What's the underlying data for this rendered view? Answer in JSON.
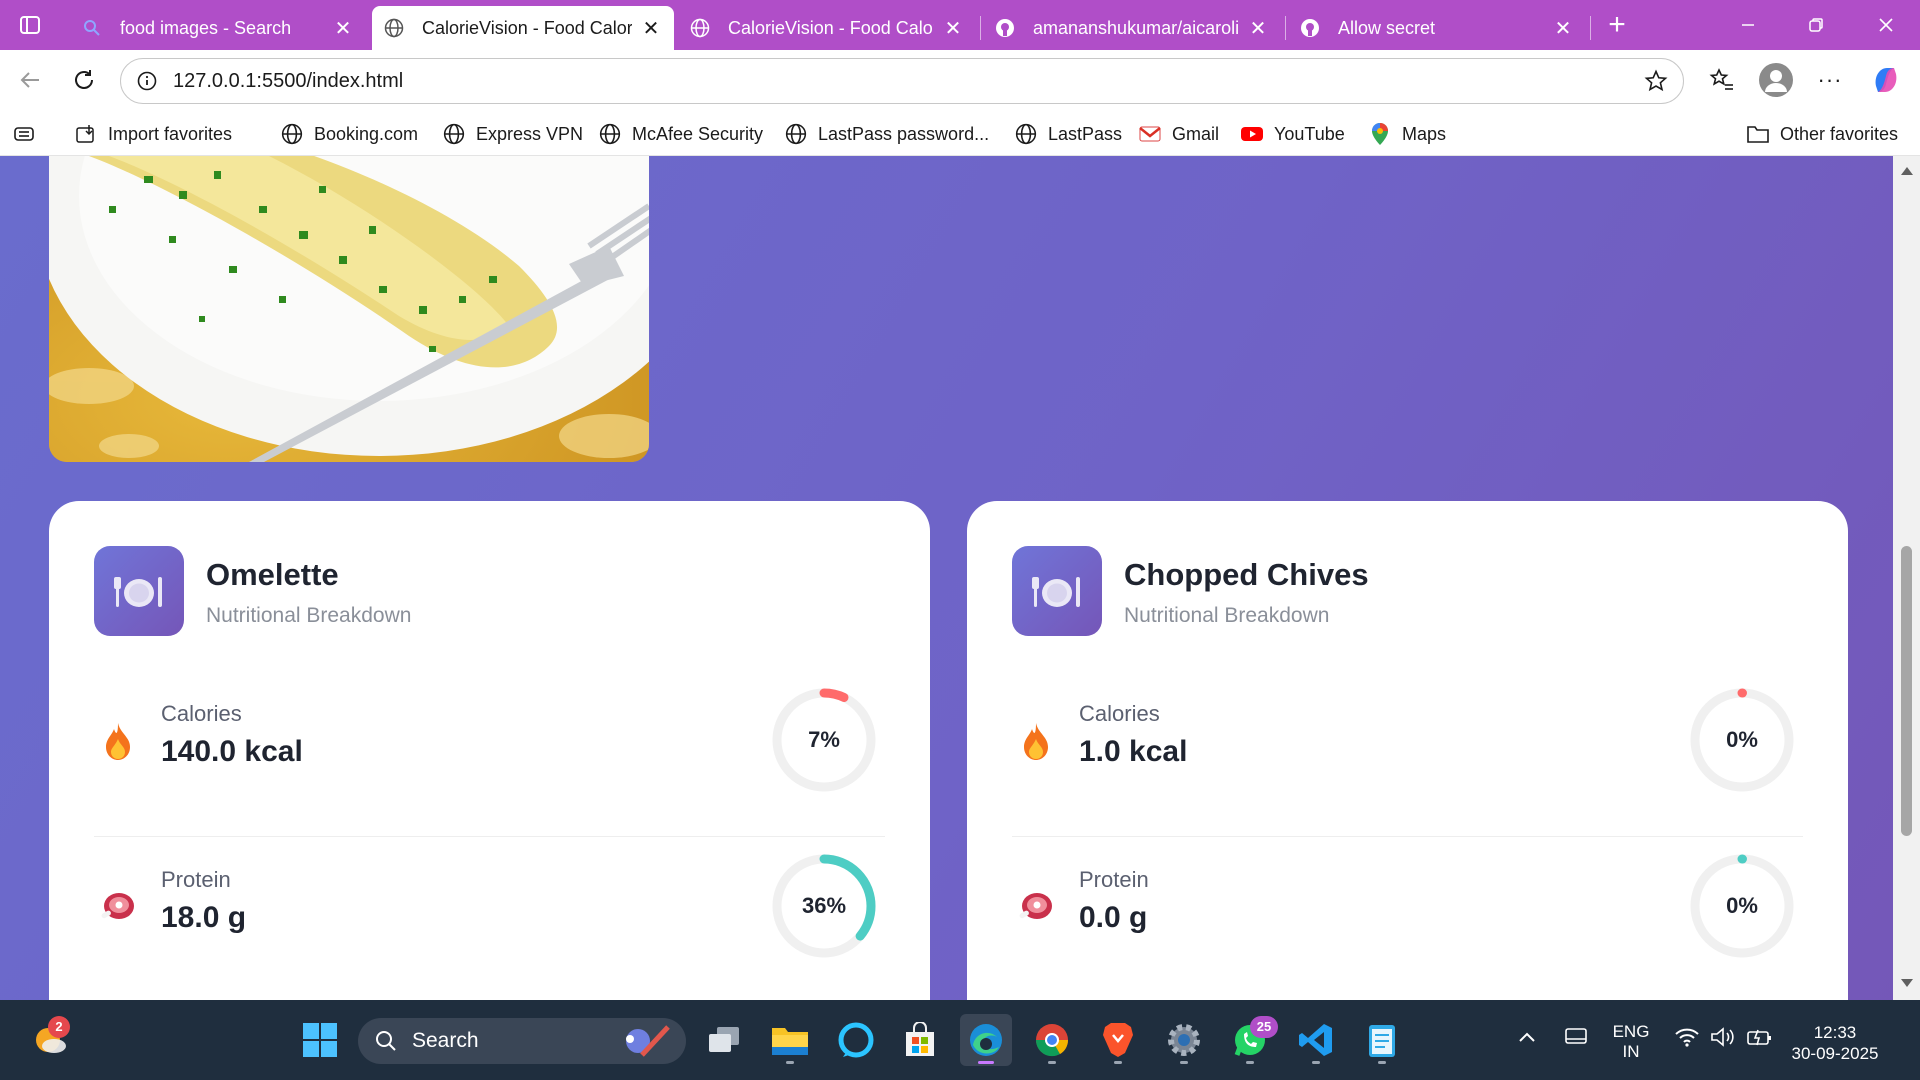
{
  "browser": {
    "tabs": [
      {
        "title": "food images - Search",
        "active": false,
        "icon": "search-icon"
      },
      {
        "title": "CalorieVision - Food Calori",
        "active": true,
        "icon": "globe-icon"
      },
      {
        "title": "CalorieVision - Food Calori",
        "active": false,
        "icon": "globe-icon"
      },
      {
        "title": "amananshukumar/aicarolie",
        "active": false,
        "icon": "github-icon"
      },
      {
        "title": "Allow secret",
        "active": false,
        "icon": "github-icon"
      }
    ],
    "url": "127.0.0.1:5500/index.html",
    "bookmarks": [
      {
        "label": "Import favorites",
        "icon": "import-icon"
      },
      {
        "label": "Booking.com",
        "icon": "globe-icon"
      },
      {
        "label": "Express VPN",
        "icon": "globe-icon"
      },
      {
        "label": "McAfee Security",
        "icon": "globe-icon"
      },
      {
        "label": "LastPass password...",
        "icon": "globe-icon"
      },
      {
        "label": "LastPass",
        "icon": "globe-icon"
      },
      {
        "label": "Gmail",
        "icon": "gmail-icon"
      },
      {
        "label": "YouTube",
        "icon": "youtube-icon"
      },
      {
        "label": "Maps",
        "icon": "maps-icon"
      }
    ],
    "other_favorites": "Other favorites"
  },
  "page": {
    "cards": [
      {
        "name": "Omelette",
        "subtitle": "Nutritional Breakdown",
        "nutrients": [
          {
            "label": "Calories",
            "value": "140.0 kcal",
            "percent": "7%",
            "fraction": 0.07,
            "color": "#ff6b6b",
            "icon": "flame-icon"
          },
          {
            "label": "Protein",
            "value": "18.0 g",
            "percent": "36%",
            "fraction": 0.36,
            "color": "#4ecdc4",
            "icon": "meat-icon"
          }
        ]
      },
      {
        "name": "Chopped Chives",
        "subtitle": "Nutritional Breakdown",
        "nutrients": [
          {
            "label": "Calories",
            "value": "1.0 kcal",
            "percent": "0%",
            "fraction": 0.0,
            "color": "#ff6b6b",
            "icon": "flame-icon"
          },
          {
            "label": "Protein",
            "value": "0.0 g",
            "percent": "0%",
            "fraction": 0.0,
            "color": "#4ecdc4",
            "icon": "meat-icon"
          }
        ]
      }
    ]
  },
  "taskbar": {
    "search_placeholder": "Search",
    "widget_badge": "2",
    "whatsapp_badge": "25",
    "language": "ENG",
    "region": "IN",
    "time": "12:33",
    "date": "30-09-2025"
  }
}
